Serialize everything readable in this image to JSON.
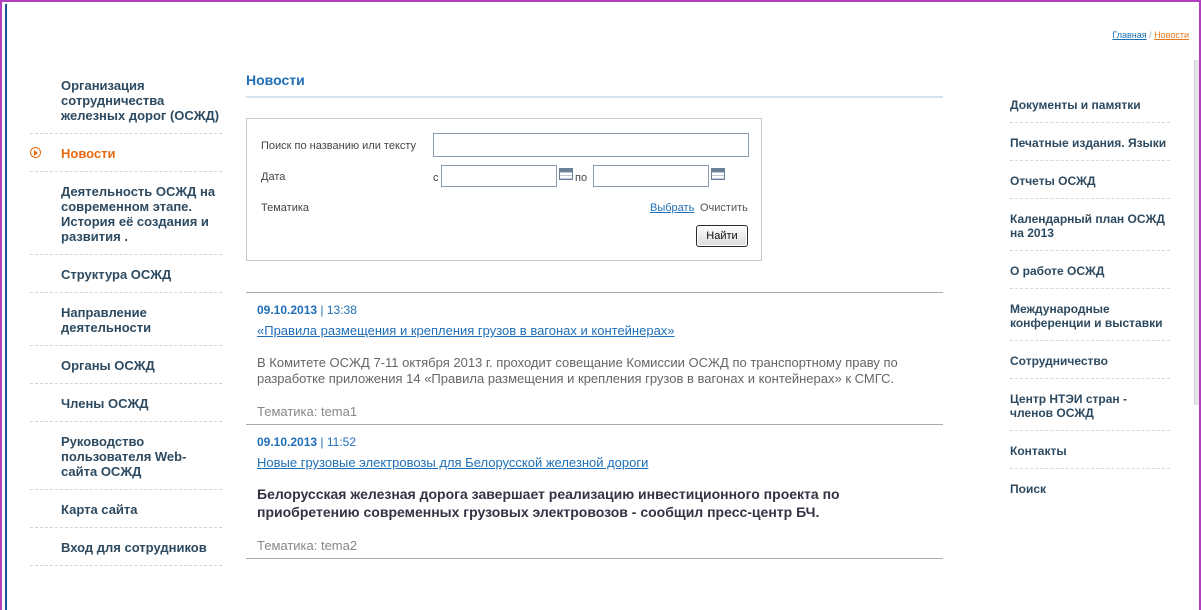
{
  "breadcrumb": {
    "home": "Главная",
    "separator": " / ",
    "current": "Новости"
  },
  "left_nav": [
    {
      "label": "Организация сотрудничества железных дорог (ОСЖД)",
      "active": false
    },
    {
      "label": "Новости",
      "active": true
    },
    {
      "label": "Деятельность ОСЖД на современном этапе. История её создания и развития .",
      "active": false
    },
    {
      "label": "Структура ОСЖД",
      "active": false
    },
    {
      "label": "Направление деятельности",
      "active": false
    },
    {
      "label": "Органы ОСЖД",
      "active": false
    },
    {
      "label": "Члены ОСЖД",
      "active": false
    },
    {
      "label": "Руководство пользователя Web-сайта ОСЖД",
      "active": false
    },
    {
      "label": "Карта сайта",
      "active": false
    },
    {
      "label": "Вход для сотрудников",
      "active": false
    }
  ],
  "main": {
    "title": "Новости",
    "search": {
      "text_label": "Поиск по названию или тексту",
      "text_value": "",
      "date_label": "Дата",
      "from_label": "с",
      "to_label": "по",
      "date_from": "",
      "date_to": "",
      "theme_label": "Тематика",
      "choose_link": "Выбрать",
      "clear_link": "Очистить",
      "find_button": "Найти"
    },
    "news": [
      {
        "date": "09.10.2013",
        "sep": " | ",
        "time": "13:38",
        "title": "«Правила размещения и крепления грузов в вагонах и контейнерах»",
        "body": "В Комитете ОСЖД 7-11 октября 2013 г. проходит совещание Комиссии ОСЖД по транспортному праву по разработке приложения 14 «Правила размещения и крепления грузов в вагонах и контейнерах» к СМГС.",
        "theme": "Тематика: tema1"
      },
      {
        "date": "09.10.2013",
        "sep": " | ",
        "time": "11:52",
        "title": "Новые грузовые электровозы для Белорусской железной дороги",
        "body": "Белорусская железная дорога завершает реализацию инвестиционного проекта по приобретению современных грузовых электровозов - сообщил пресс-центр БЧ.",
        "theme": "Тематика: tema2"
      }
    ]
  },
  "right_nav": [
    "Документы и памятки",
    "Печатные издания. Языки",
    "Отчеты ОСЖД",
    "Календарный план ОСЖД на 2013",
    "О работе ОСЖД",
    "Международные конференции и выставки",
    "Сотрудничество",
    "Центр НТЭИ стран - членов ОСЖД",
    "Контакты",
    "Поиск"
  ]
}
